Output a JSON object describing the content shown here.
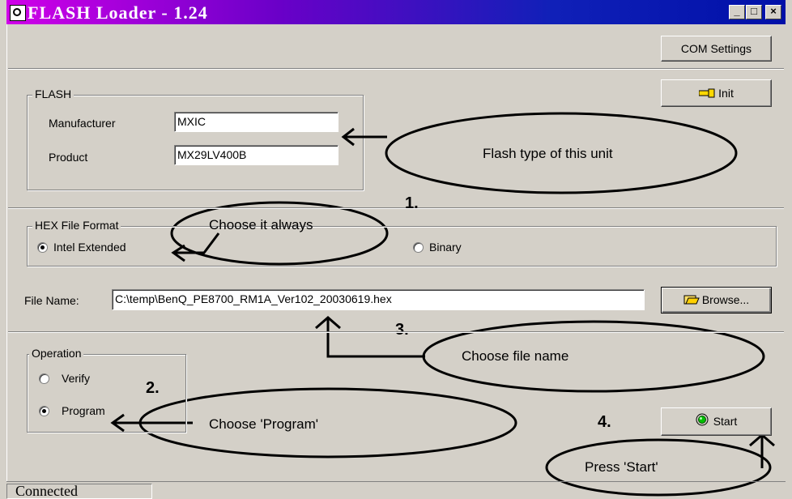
{
  "window": {
    "title": "FLASH Loader - 1.24",
    "controls": {
      "minimize": "_",
      "maximize": "□",
      "close": "×"
    }
  },
  "toolbar": {
    "com_settings_label": "COM Settings",
    "init_label": "Init"
  },
  "flash": {
    "group_label": "FLASH",
    "manufacturer_label": "Manufacturer",
    "manufacturer_value": "MXIC",
    "product_label": "Product",
    "product_value": "MX29LV400B"
  },
  "hex_format": {
    "group_label": "HEX File Format",
    "options": [
      "Intel Extended",
      "Binary"
    ],
    "selected": "Intel Extended"
  },
  "file": {
    "label": "File Name:",
    "value": "C:\\temp\\BenQ_PE8700_RM1A_Ver102_20030619.hex",
    "browse_label": "Browse..."
  },
  "operation": {
    "group_label": "Operation",
    "options": [
      "Verify",
      "Program"
    ],
    "selected": "Program"
  },
  "start_label": "Start",
  "status": {
    "text": "Connected"
  },
  "annotations": {
    "flash_type": "Flash type of this unit",
    "step1_number": "1.",
    "step1_text": "Choose it always",
    "step2_number": "2.",
    "step2_text": "Choose 'Program'",
    "step3_number": "3.",
    "step3_text": "Choose file name",
    "step4_number": "4.",
    "step4_text": "Press 'Start'"
  },
  "icons": {
    "app": "app-icon",
    "init": "hand-pointer-icon",
    "browse": "folder-open-icon",
    "start": "green-led-icon"
  }
}
